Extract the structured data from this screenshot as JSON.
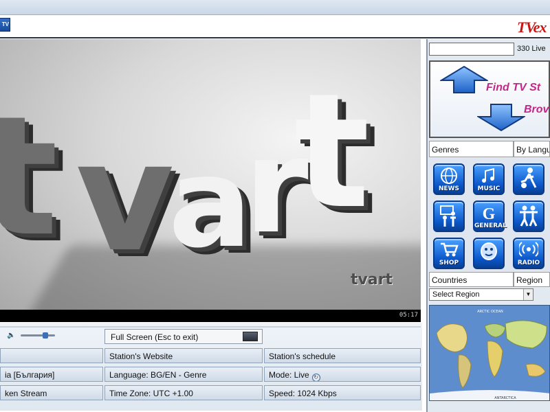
{
  "header": {
    "brand": "TVex",
    "corner_logo": "TV"
  },
  "video": {
    "letters": [
      "t",
      "v",
      "a",
      "r",
      "t"
    ],
    "watermark": "tvart",
    "timecode": "05:17"
  },
  "controls": {
    "fullscreen_label": "Full Screen (Esc to exit)",
    "station_website": "Station's Website",
    "station_schedule": "Station's schedule",
    "country": "ia [България]",
    "language": "Language: BG/EN   - Genre",
    "mode": "Mode: Live",
    "stream": "ken Stream",
    "timezone": "Time Zone: UTC +1.00",
    "speed": "Speed: 1024 Kbps"
  },
  "sidebar": {
    "search_value": "",
    "live_count": "330 Live",
    "find_text": "Find TV St",
    "browse_text": "Brov",
    "tab_genres": "Genres",
    "tab_languages": "By Langu",
    "tab_countries": "Countries",
    "tab_region": "Region",
    "region_select": "Select Region",
    "genres": [
      {
        "label": "NEWS",
        "icon": "globe-icon"
      },
      {
        "label": "MUSIC",
        "icon": "music-icon"
      },
      {
        "label": "",
        "icon": "sports-icon"
      },
      {
        "label": "",
        "icon": "education-icon"
      },
      {
        "label": "GENERAL",
        "icon": "general-icon"
      },
      {
        "label": "",
        "icon": "dance-icon"
      },
      {
        "label": "SHOP",
        "icon": "cart-icon"
      },
      {
        "label": "",
        "icon": "kids-icon"
      },
      {
        "label": "RADIO",
        "icon": "radio-icon"
      }
    ],
    "map_labels": [
      "ARCTIC OCEAN",
      "ANTARCTICA"
    ]
  },
  "colors": {
    "brand": "#cc1212",
    "accent": "#c2288a",
    "genre_blue": "#0b56c8"
  }
}
